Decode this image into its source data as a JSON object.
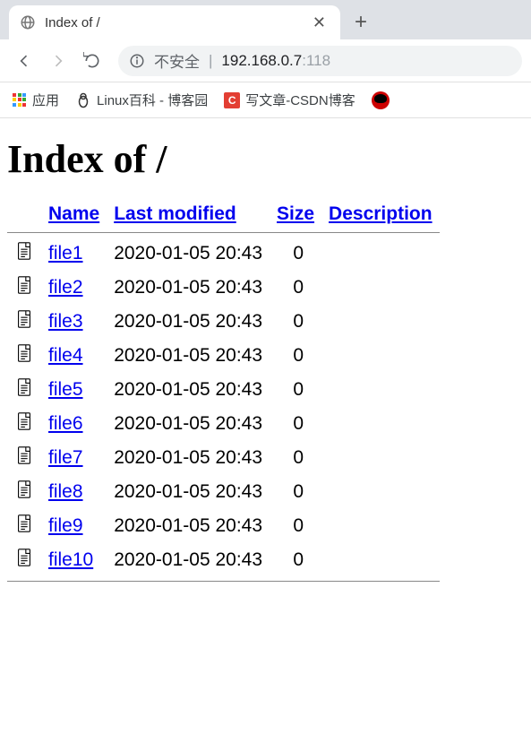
{
  "browser": {
    "tab_title": "Index of /",
    "address": {
      "insecure_label": "不安全",
      "host": "192.168.0.7",
      "port": ":118"
    },
    "bookmarks": {
      "apps": "应用",
      "item1": "Linux百科 - 博客园",
      "item2": "写文章-CSDN博客"
    }
  },
  "page": {
    "heading": "Index of /",
    "columns": {
      "name": "Name",
      "modified": "Last modified",
      "size": "Size",
      "desc": "Description"
    },
    "files": [
      {
        "name": "file1",
        "modified": "2020-01-05 20:43",
        "size": "0"
      },
      {
        "name": "file2",
        "modified": "2020-01-05 20:43",
        "size": "0"
      },
      {
        "name": "file3",
        "modified": "2020-01-05 20:43",
        "size": "0"
      },
      {
        "name": "file4",
        "modified": "2020-01-05 20:43",
        "size": "0"
      },
      {
        "name": "file5",
        "modified": "2020-01-05 20:43",
        "size": "0"
      },
      {
        "name": "file6",
        "modified": "2020-01-05 20:43",
        "size": "0"
      },
      {
        "name": "file7",
        "modified": "2020-01-05 20:43",
        "size": "0"
      },
      {
        "name": "file8",
        "modified": "2020-01-05 20:43",
        "size": "0"
      },
      {
        "name": "file9",
        "modified": "2020-01-05 20:43",
        "size": "0"
      },
      {
        "name": "file10",
        "modified": "2020-01-05 20:43",
        "size": "0"
      }
    ]
  }
}
